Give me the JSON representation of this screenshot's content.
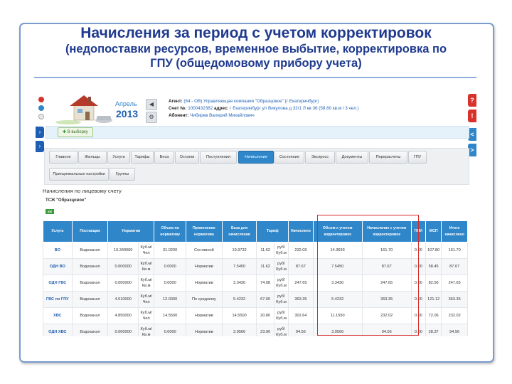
{
  "slide": {
    "title_line1": "Начисления за период с учетом корректировок",
    "title_line2": "(недопоставки ресурсов, временное выбытие, корректировка по",
    "title_line3": "ГПУ (общедомовому прибору учета)"
  },
  "app": {
    "month": "Апрель",
    "year": "2013",
    "agent_label": "Агент:",
    "agent_value": "(64 - ОВ) Управляющая компания \"Образцовое\" (г Екатеринбург)",
    "account_label": "Счет №:",
    "account_value": "1000432362",
    "address_label": "адрес:",
    "address_value": "г Екатеринбург ул Викулова д 32/1 Л кв 36 (58.60 кв.м / 3 чел.)",
    "subscriber_label": "Абонент:",
    "subscriber_value": "Чибирев Валерий Михайлович",
    "select_button": "В выборку",
    "nav_prev_icon": "triangle-left",
    "nav_settings_icon": "gear",
    "right_tabs": [
      "?",
      "!",
      "<",
      ">"
    ],
    "right_tab_colors": [
      "#d9312b",
      "#d9312b",
      "#2f86c9",
      "#2f86c9"
    ]
  },
  "tabs_row1": [
    "Главное",
    "Жильцы",
    "Услуги",
    "Тарифы",
    "Веса",
    "Остатки",
    "Поступления",
    "Начисления",
    "Состояние",
    "Экспресс",
    "Документы",
    "Перерасчеты",
    "ГПУ"
  ],
  "tabs_row2": [
    "Принципиальные настройки",
    "Группы"
  ],
  "active_tab": "Начисления",
  "section_title": "Начисления по лицевому счету",
  "org_name": "ТСЖ \"Образцовое\"",
  "export_label": "xls",
  "table": {
    "headers": [
      "Услуга",
      "Поставщик",
      "Норматив",
      "",
      "Объем по нормативу",
      "Применение норматива",
      "База для начисления",
      "Тариф",
      "",
      "Начислено",
      "Объем с учетом корректировок",
      "Начисление с учетом корректировок",
      "ПЛИ",
      "МСП",
      "Итого начислено"
    ],
    "rows": [
      [
        "ВО",
        "Водоканал",
        "10.340000",
        "Куб.м/ Чел",
        "31.0200",
        "Составной",
        "19.9732",
        "11.62",
        "руб/ Куб.м",
        "232.09",
        "14.3693",
        "161.70",
        "0.00",
        "107.80",
        "161.70"
      ],
      [
        "ОДН ВО",
        "Водоканал",
        "0.000000",
        "Куб.м/ Кв.м",
        "0.0000",
        "Норматив",
        "7.5450",
        "11.62",
        "руб/ Куб.м",
        "87.67",
        "7.5450",
        "87.67",
        "0.00",
        "58.45",
        "87.67"
      ],
      [
        "ОДН ГВС",
        "Водоканал",
        "0.000000",
        "Куб.м/ Кв.м",
        "0.0000",
        "Норматив",
        "3.3430",
        "74.08",
        "руб/ Куб.м",
        "247.65",
        "3.3430",
        "247.65",
        "0.00",
        "82.56",
        "247.65"
      ],
      [
        "ГВС по ГПУ",
        "Водоканал",
        "4.010000",
        "Куб.м/ Чел",
        "12.0300",
        "По среднему",
        "5.4232",
        "67.00",
        "руб/ Куб.м",
        "363.35",
        "5.4232",
        "363.35",
        "0.00",
        "121.12",
        "363.35"
      ],
      [
        "ХВС",
        "Водоканал",
        "4.850000",
        "Куб.м/ Чел",
        "14.5500",
        "Норматив",
        "14.5500",
        "20.80",
        "руб/ Куб.м",
        "302.64",
        "11.1550",
        "232.02",
        "0.00",
        "72.06",
        "232.02"
      ],
      [
        "ОДН ХВС",
        "Водоканал",
        "0.000000",
        "Куб.м/ Кв.м",
        "0.0000",
        "Норматив",
        "3.9566",
        "23.90",
        "руб/ Куб.м",
        "94.56",
        "3.9566",
        "94.56",
        "0.00",
        "28.37",
        "94.56"
      ]
    ]
  },
  "highlight_color": "#d62b2b"
}
